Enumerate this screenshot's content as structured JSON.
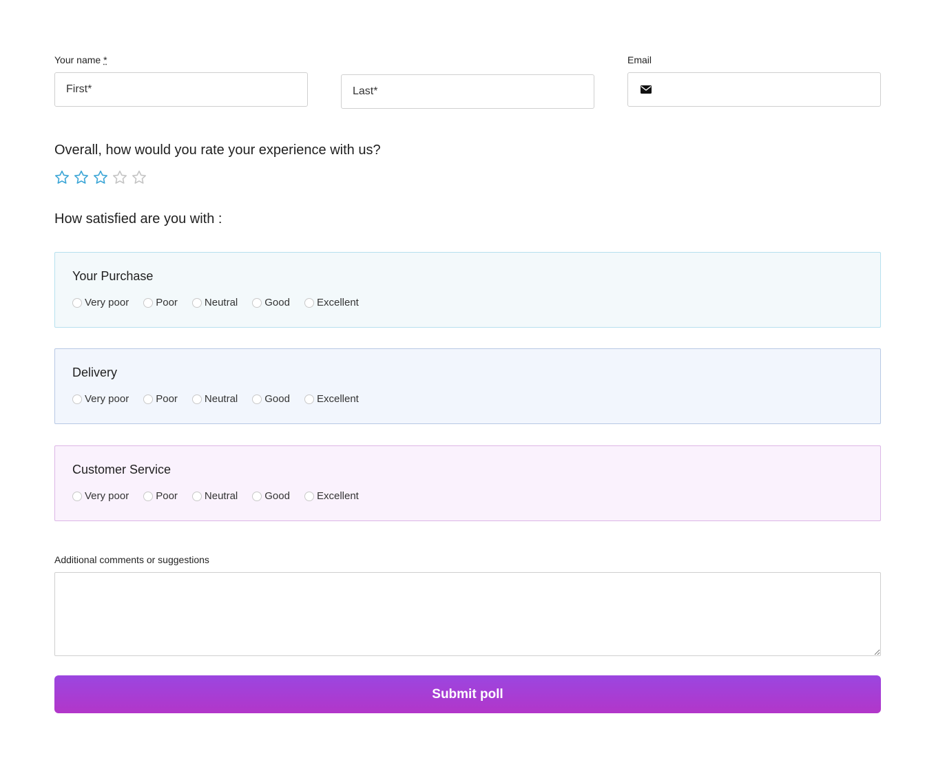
{
  "name": {
    "label": "Your name",
    "required_mark": "*",
    "first_placeholder": "First*",
    "last_placeholder": "Last*"
  },
  "email": {
    "label": "Email",
    "icon": "envelope-icon"
  },
  "rating": {
    "question": "Overall, how would you rate your experience with us?",
    "max": 5,
    "value": 3,
    "active_color": "#3aa5d6",
    "inactive_color": "#c4c4c4"
  },
  "satisfaction": {
    "question": "How satisfied are you with :",
    "options": [
      "Very poor",
      "Poor",
      "Neutral",
      "Good",
      "Excellent"
    ],
    "panels": [
      {
        "title": "Your Purchase",
        "bg": "#f3f9fb",
        "border": "#b6e0ee"
      },
      {
        "title": "Delivery",
        "bg": "#f2f6fd",
        "border": "#b7c8e4"
      },
      {
        "title": "Customer Service",
        "bg": "#faf2fd",
        "border": "#dcb6e6"
      }
    ]
  },
  "comments": {
    "label": "Additional comments or suggestions",
    "value": ""
  },
  "submit": {
    "label": "Submit poll"
  }
}
